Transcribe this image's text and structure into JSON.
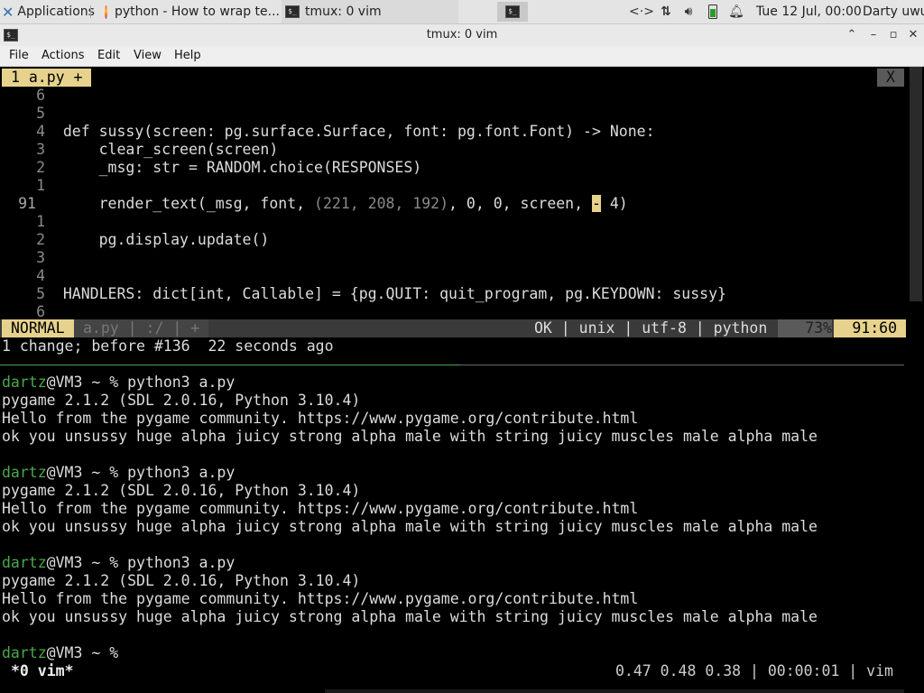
{
  "panel": {
    "applications": "Applications",
    "tasks": [
      {
        "label": "python - How to wrap te..."
      },
      {
        "label": "tmux: 0 vim"
      }
    ],
    "clock": "Tue 12 Jul, 00:00",
    "user": "Darty uwu",
    "tray_icons": [
      "network-arrows-icon",
      "network-updown-icon",
      "volume-icon",
      "battery-icon",
      "notification-bell-icon"
    ]
  },
  "window": {
    "title": "tmux: 0 vim",
    "menu": [
      "File",
      "Actions",
      "Edit",
      "View",
      "Help"
    ]
  },
  "vim": {
    "tab_label": "1 a.py +",
    "tab_close": "X",
    "lines": [
      {
        "num": "6",
        "text": ""
      },
      {
        "num": "5",
        "text": ""
      },
      {
        "num": "4",
        "text": "def sussy(screen: pg.surface.Surface, font: pg.font.Font) -> None:"
      },
      {
        "num": "3",
        "text": "    clear_screen(screen)"
      },
      {
        "num": "2",
        "text": "    _msg: str = RANDOM.choice(RESPONSES)"
      },
      {
        "num": "1",
        "text": ""
      },
      {
        "num": "91",
        "pre": "    render_text(_msg, font, ",
        "tuple": "(221, 208, 192)",
        "mid": ", 0, 0, screen, ",
        "cursor": "-",
        "post": " 4)"
      },
      {
        "num": "1",
        "text": ""
      },
      {
        "num": "2",
        "text": "    pg.display.update()"
      },
      {
        "num": "3",
        "text": ""
      },
      {
        "num": "4",
        "text": ""
      },
      {
        "num": "5",
        "text": "HANDLERS: dict[int, Callable] = {pg.QUIT: quit_program, pg.KEYDOWN: sussy}"
      },
      {
        "num": "6",
        "text": ""
      }
    ],
    "status": {
      "mode": "NORMAL",
      "file": "a.py | :/ | +",
      "info": "OK | unix | utf-8 | python",
      "percent": "73%",
      "position": "91:60"
    },
    "message": "1 change; before #136  22 seconds ago"
  },
  "shell": {
    "prompt_user": "dartz",
    "prompt_rest": "@VM3 ~ % ",
    "command": "python3 a.py",
    "runs": [
      {
        "lines": [
          "pygame 2.1.2 (SDL 2.0.16, Python 3.10.4)",
          "Hello from the pygame community. https://www.pygame.org/contribute.html",
          "ok you unsussy huge alpha juicy strong alpha male with string juicy muscles male alpha male"
        ]
      },
      {
        "lines": [
          "pygame 2.1.2 (SDL 2.0.16, Python 3.10.4)",
          "Hello from the pygame community. https://www.pygame.org/contribute.html",
          "ok you unsussy huge alpha juicy strong alpha male with string juicy muscles male alpha male"
        ]
      },
      {
        "lines": [
          "pygame 2.1.2 (SDL 2.0.16, Python 3.10.4)",
          "Hello from the pygame community. https://www.pygame.org/contribute.html",
          "ok you unsussy huge alpha juicy strong alpha male with string juicy muscles male alpha male"
        ]
      }
    ]
  },
  "tmux": {
    "window_label": "*0 vim*",
    "right": "0.47 0.48 0.38 | 00:00:01 | vim"
  }
}
